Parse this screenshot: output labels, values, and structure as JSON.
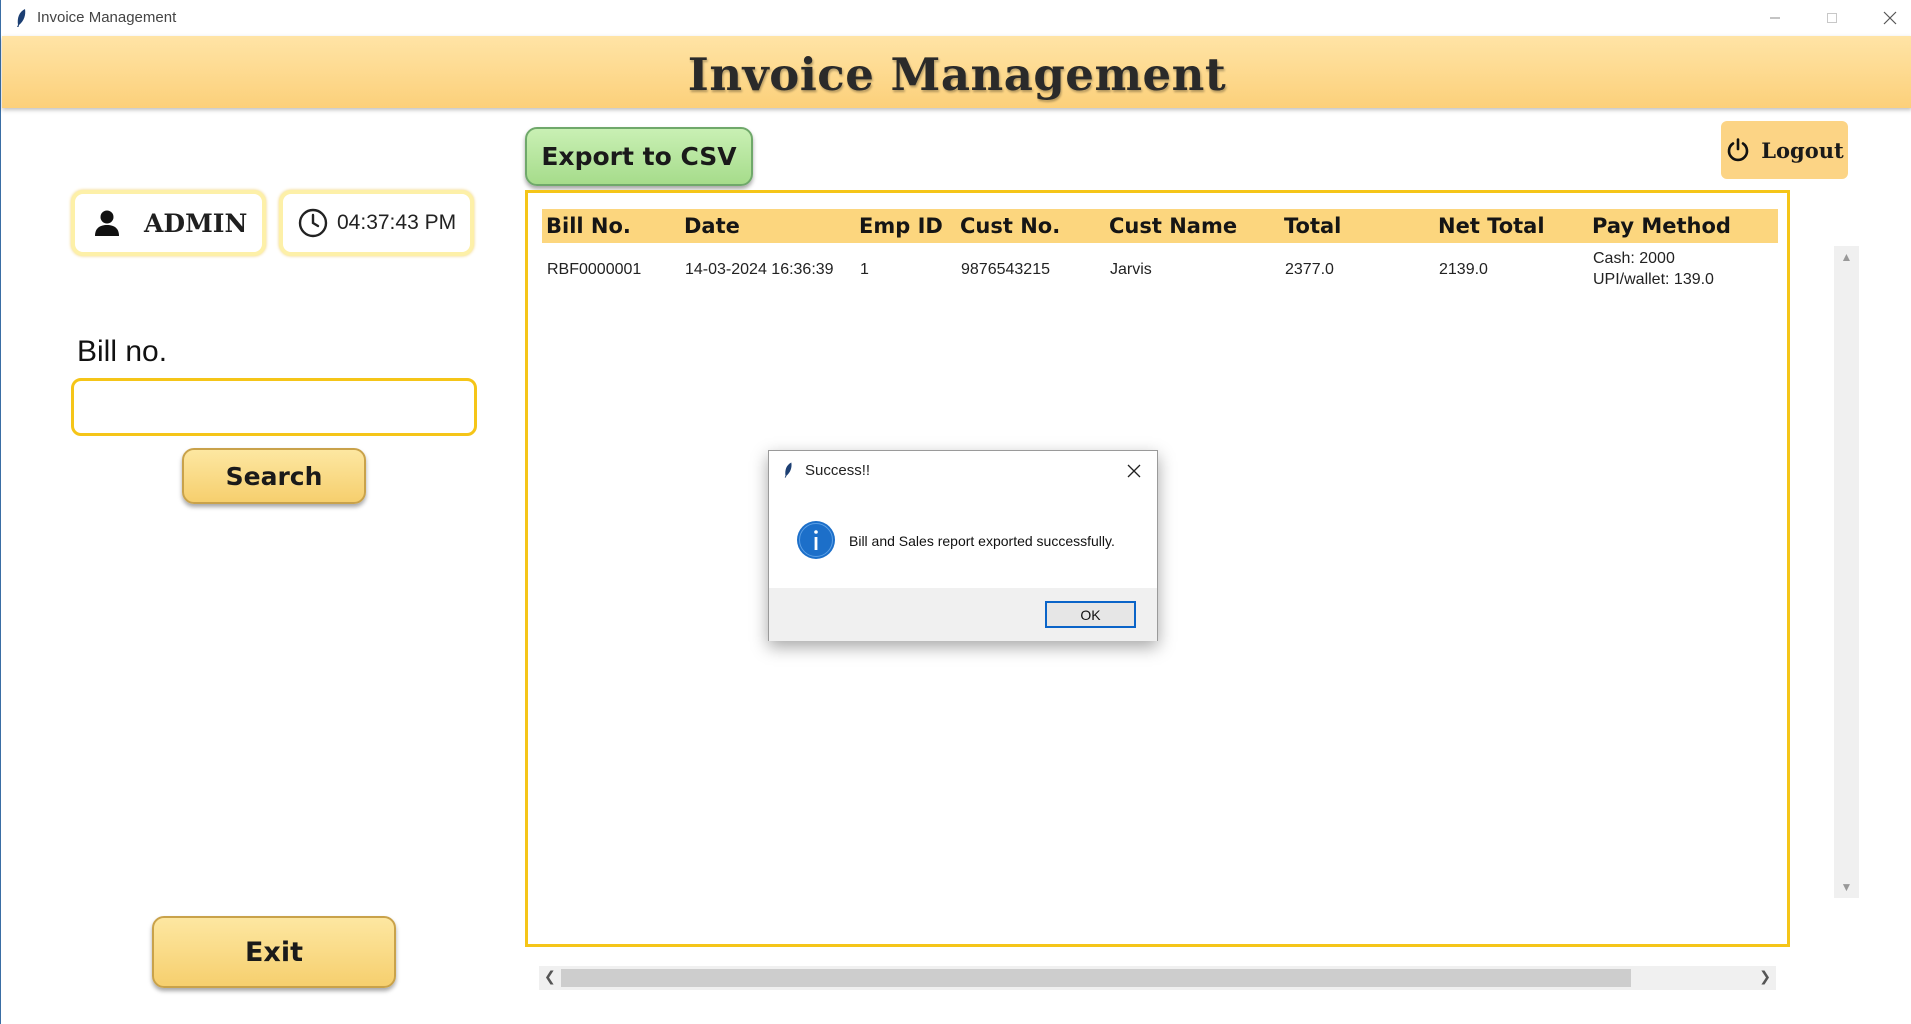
{
  "window": {
    "title": "Invoice Management",
    "controls": {
      "minimize": "minimize-icon",
      "maximize": "maximize-icon",
      "close": "close-icon"
    }
  },
  "header": {
    "title": "Invoice Management"
  },
  "colors": {
    "header_bg": "#fcd07a",
    "accent_border": "#f5c518",
    "export_green": "#a6dc8b",
    "button_yellow": "#f6cf6e",
    "ok_blue": "#0a64c8"
  },
  "user": {
    "name": "ADMIN",
    "icon": "user-icon"
  },
  "clock": {
    "time": "04:37:43 PM",
    "icon": "clock-icon"
  },
  "search": {
    "label": "Bill no.",
    "value": "",
    "button_label": "Search"
  },
  "exit": {
    "label": "Exit"
  },
  "toolbar": {
    "export_label": "Export to CSV",
    "logout_label": "Logout",
    "logout_icon": "power-icon"
  },
  "table": {
    "columns": [
      "Bill No.",
      "Date",
      "Emp ID",
      "Cust No.",
      "Cust Name",
      "Total",
      "Net Total",
      "Pay Method"
    ],
    "rows": [
      {
        "bill_no": "RBF0000001",
        "date": "14-03-2024 16:36:39",
        "emp_id": "1",
        "cust_no": "9876543215",
        "cust_name": "Jarvis",
        "total": "2377.0",
        "net_total": "2139.0",
        "pay_method_line1": "Cash: 2000",
        "pay_method_line2": "UPI/wallet: 139.0"
      }
    ]
  },
  "dialog": {
    "title": "Success!!",
    "message": "Bill and Sales report exported successfully.",
    "ok_label": "OK",
    "icon": "info-icon"
  }
}
